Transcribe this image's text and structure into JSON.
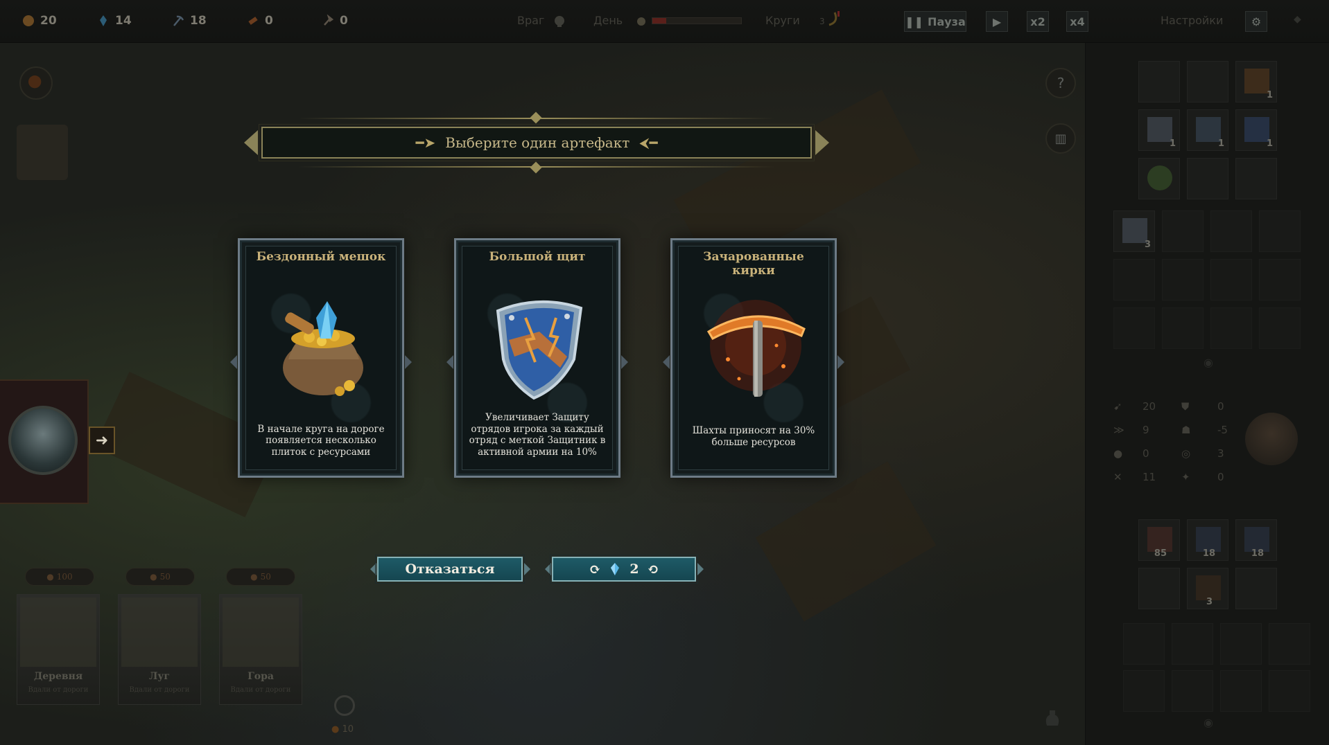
{
  "topbar": {
    "resources": [
      {
        "icon": "gold-coin-icon",
        "value": "20"
      },
      {
        "icon": "crystal-icon",
        "value": "14"
      },
      {
        "icon": "pickaxe-icon",
        "value": "18"
      },
      {
        "icon": "wood-icon",
        "value": "0"
      },
      {
        "icon": "axe-icon",
        "value": "0"
      }
    ],
    "enemy_label": "Враг",
    "day_label": "День",
    "laps_label": "Круги",
    "laps_value": "3",
    "pause_label": "Пауза",
    "speed2_label": "x2",
    "speed4_label": "x4",
    "settings_label": "Настройки"
  },
  "modal": {
    "title": "Выберите один артефакт",
    "cards": [
      {
        "name": "Бездонный мешок",
        "description": "В начале круга на дороге появляется несколько плиток с ресурсами",
        "icon": "loot-sack-icon"
      },
      {
        "name": "Большой щит",
        "description": "Увеличивает Защиту отрядов игрока за каждый отряд с меткой Защитник в активной армии на 10%",
        "icon": "shield-icon"
      },
      {
        "name": "Зачарованные кирки",
        "description": "Шахты приносят на 30% больше ресурсов",
        "icon": "pickaxe-icon"
      }
    ],
    "decline_label": "Отказаться",
    "reroll_cost": "2"
  },
  "bottom_cards": [
    {
      "title": "Деревня",
      "subtitle": "Вдали от дороги",
      "cost": "100"
    },
    {
      "title": "Луг",
      "subtitle": "Вдали от дороги",
      "cost": "50"
    },
    {
      "title": "Гора",
      "subtitle": "Вдали от дороги",
      "cost": "50"
    }
  ],
  "bottom_cost": "10",
  "right_panel": {
    "inventory_counts": [
      "1",
      "1",
      "1",
      "1",
      "3"
    ],
    "stats": [
      "20",
      "0",
      "9",
      "-5",
      "0",
      "3",
      "11",
      "0"
    ],
    "units": [
      "85",
      "18",
      "18",
      "3"
    ]
  }
}
